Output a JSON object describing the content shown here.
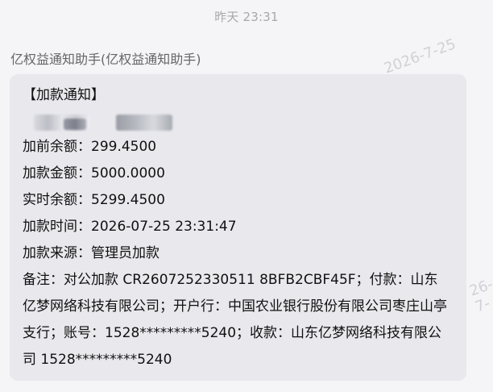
{
  "chat": {
    "timestamp": "昨天 23:31",
    "sender_name": "亿权益通知助手(亿权益通知助手)",
    "watermark_text": "2026-7-25",
    "watermark_fragment": "26-7-"
  },
  "message": {
    "heading": "【加款通知】",
    "fields": [
      {
        "label": "加前余额",
        "value": "299.4500"
      },
      {
        "label": "加款金额",
        "value": "5000.0000"
      },
      {
        "label": "实时余额",
        "value": "5299.4500"
      },
      {
        "label": "加款时间",
        "value": "2026-07-25 23:31:47"
      },
      {
        "label": "加款来源",
        "value": "管理员加款"
      }
    ],
    "memo": "备注：对公加款 CR2607252330511 8BFB2CBF45F；付款：山东亿梦网络科技有限公司；开户行：中国农业银行股份有限公司枣庄山亭支行；账号：1528*********5240；收款：山东亿梦网络科技有限公司 1528*********5240"
  }
}
